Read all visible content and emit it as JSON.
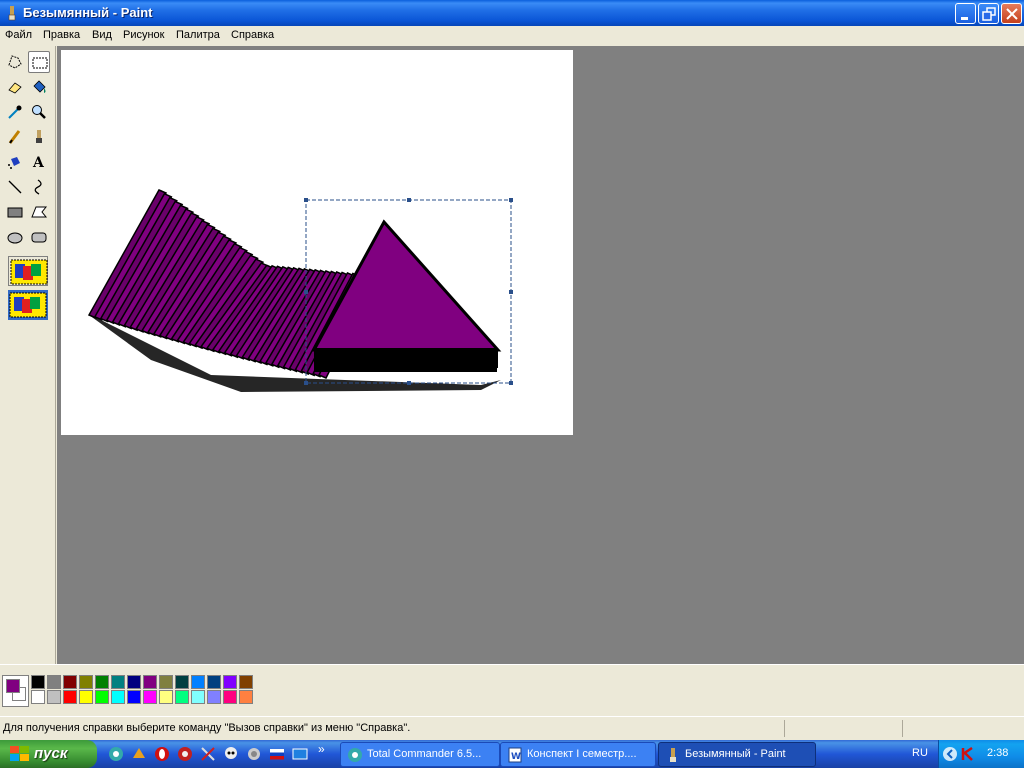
{
  "window": {
    "title": "Безымянный - Paint"
  },
  "menu": [
    "Файл",
    "Правка",
    "Вид",
    "Рисунок",
    "Палитра",
    "Справка"
  ],
  "tools": [
    {
      "name": "free-select-icon"
    },
    {
      "name": "rect-select-icon"
    },
    {
      "name": "eraser-icon"
    },
    {
      "name": "fill-icon"
    },
    {
      "name": "color-picker-icon"
    },
    {
      "name": "magnifier-icon"
    },
    {
      "name": "pencil-icon"
    },
    {
      "name": "brush-icon"
    },
    {
      "name": "airbrush-icon"
    },
    {
      "name": "text-icon"
    },
    {
      "name": "line-icon"
    },
    {
      "name": "curve-icon"
    },
    {
      "name": "rectangle-icon"
    },
    {
      "name": "polygon-icon"
    },
    {
      "name": "ellipse-icon"
    },
    {
      "name": "rounded-rect-icon"
    }
  ],
  "selected_tool": "rect-select-icon",
  "text_tool_glyph": "A",
  "colors": {
    "foreground": "#800080",
    "background": "#ffffff",
    "palette_top": [
      "#000000",
      "#808080",
      "#800000",
      "#808000",
      "#008000",
      "#008080",
      "#000080",
      "#800080",
      "#808040",
      "#004040",
      "#0080ff",
      "#004080",
      "#8000ff",
      "#804000"
    ],
    "palette_bottom": [
      "#ffffff",
      "#c0c0c0",
      "#ff0000",
      "#ffff00",
      "#00ff00",
      "#00ffff",
      "#0000ff",
      "#ff00ff",
      "#ffff80",
      "#00ff80",
      "#80ffff",
      "#8080ff",
      "#ff0080",
      "#ff8040"
    ]
  },
  "status": {
    "help_text": "Для получения справки выберите команду \"Вызов справки\" из меню \"Справка\"."
  },
  "taskbar": {
    "start_label": "пуск",
    "more_label": "»",
    "tasks": [
      {
        "label": "Total Commander 6.5..."
      },
      {
        "label": "Конспект I семестр...."
      },
      {
        "label": "Безымянный - Paint"
      }
    ],
    "language": "RU",
    "clock": "2:38"
  }
}
